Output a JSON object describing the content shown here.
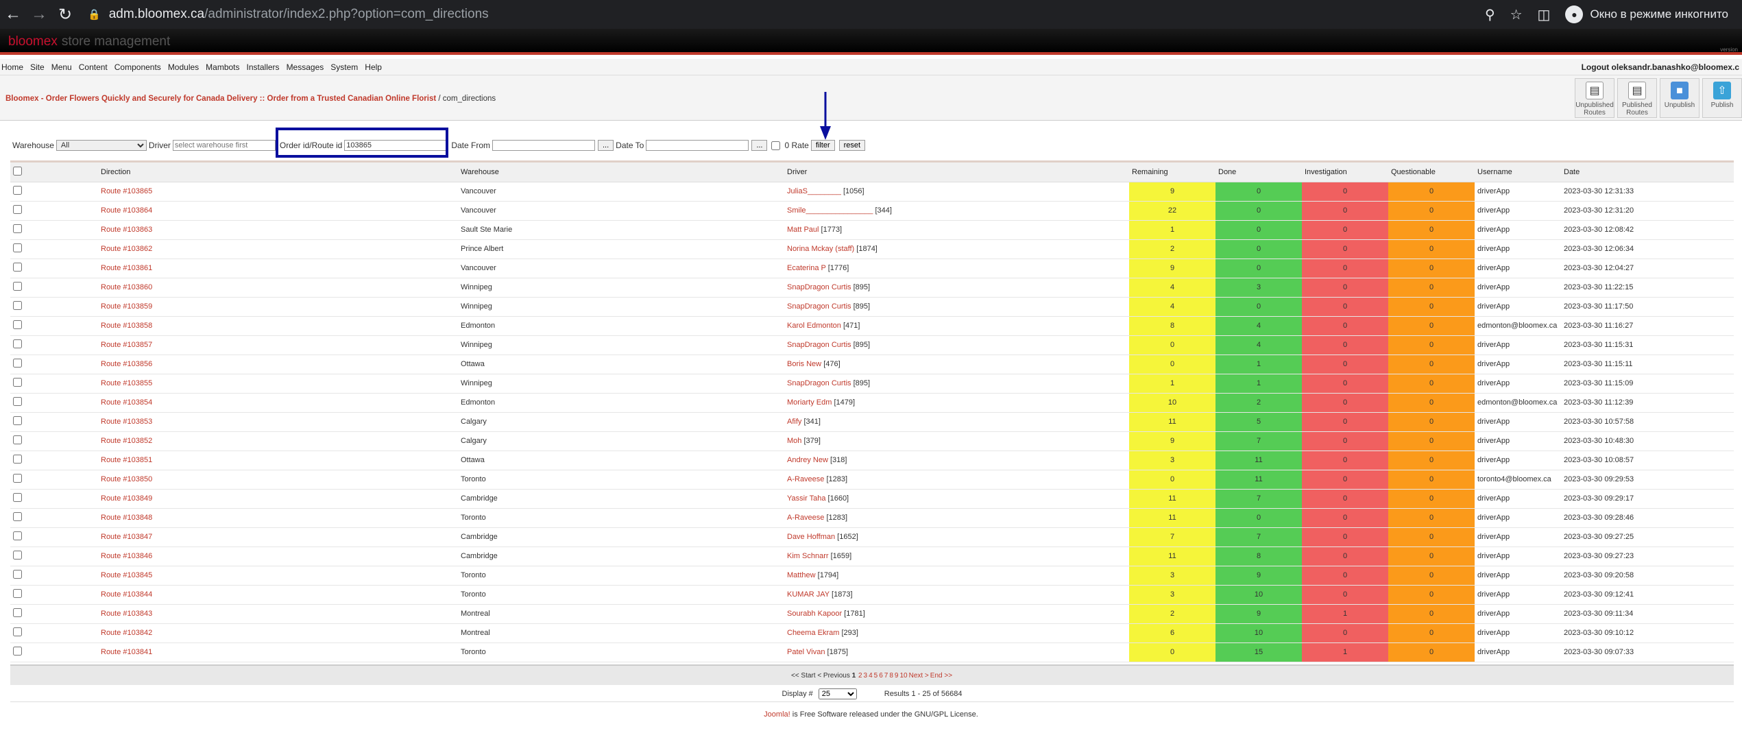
{
  "browser": {
    "url_host": "adm.bloomex.ca",
    "url_path": "/administrator/index2.php?option=com_directions",
    "incognito_label": "Окно в режиме инкогнито"
  },
  "header": {
    "brand_name": "bloomex",
    "brand_suffix": "store management",
    "version": "version"
  },
  "menu": {
    "items": [
      "Home",
      "Site",
      "Menu",
      "Content",
      "Components",
      "Modules",
      "Mambots",
      "Installers",
      "Messages",
      "System",
      "Help"
    ],
    "logout": "Logout oleksandr.banashko@bloomex.c"
  },
  "breadcrumb": {
    "site": "Bloomex - Order Flowers Quickly and Securely for Canada Delivery :: Order from a Trusted Canadian Online Florist",
    "component": "/ com_directions"
  },
  "toolbar": [
    {
      "label": "Unpublished Routes",
      "icon": "doc-icon"
    },
    {
      "label": "Published Routes",
      "icon": "doc-icon"
    },
    {
      "label": "Unpublish",
      "icon": "folder-icon"
    },
    {
      "label": "Publish",
      "icon": "publish-icon"
    }
  ],
  "filters": {
    "warehouse_label": "Warehouse",
    "warehouse_value": "All",
    "driver_label": "Driver",
    "driver_placeholder": "select warehouse first",
    "order_label": "Order id/Route id",
    "order_value": "103865",
    "date_from_label": "Date From",
    "date_to_label": "Date To",
    "picker_label": "...",
    "rate_label": "0 Rate",
    "filter_button": "filter",
    "reset_button": "reset"
  },
  "table": {
    "headers": {
      "direction": "Direction",
      "warehouse": "Warehouse",
      "driver": "Driver",
      "remaining": "Remaining",
      "done": "Done",
      "investigation": "Investigation",
      "questionable": "Questionable",
      "username": "Username",
      "date": "Date"
    },
    "rows": [
      {
        "route": "Route #103865",
        "warehouse": "Vancouver",
        "driver": "JuliaS________",
        "driver_id": "[1056]",
        "remaining": "9",
        "done": "0",
        "inv": "0",
        "que": "0",
        "user": "driverApp",
        "date": "2023-03-30 12:31:33"
      },
      {
        "route": "Route #103864",
        "warehouse": "Vancouver",
        "driver": "Smile________________",
        "driver_id": "[344]",
        "remaining": "22",
        "done": "0",
        "inv": "0",
        "que": "0",
        "user": "driverApp",
        "date": "2023-03-30 12:31:20"
      },
      {
        "route": "Route #103863",
        "warehouse": "Sault Ste Marie",
        "driver": "Matt Paul",
        "driver_id": "[1773]",
        "remaining": "1",
        "done": "0",
        "inv": "0",
        "que": "0",
        "user": "driverApp",
        "date": "2023-03-30 12:08:42"
      },
      {
        "route": "Route #103862",
        "warehouse": "Prince Albert",
        "driver": "Norina Mckay (staff)",
        "driver_id": "[1874]",
        "remaining": "2",
        "done": "0",
        "inv": "0",
        "que": "0",
        "user": "driverApp",
        "date": "2023-03-30 12:06:34"
      },
      {
        "route": "Route #103861",
        "warehouse": "Vancouver",
        "driver": "Ecaterina P",
        "driver_id": "[1776]",
        "remaining": "9",
        "done": "0",
        "inv": "0",
        "que": "0",
        "user": "driverApp",
        "date": "2023-03-30 12:04:27"
      },
      {
        "route": "Route #103860",
        "warehouse": "Winnipeg",
        "driver": "SnapDragon Curtis",
        "driver_id": "[895]",
        "remaining": "4",
        "done": "3",
        "inv": "0",
        "que": "0",
        "user": "driverApp",
        "date": "2023-03-30 11:22:15"
      },
      {
        "route": "Route #103859",
        "warehouse": "Winnipeg",
        "driver": "SnapDragon Curtis",
        "driver_id": "[895]",
        "remaining": "4",
        "done": "0",
        "inv": "0",
        "que": "0",
        "user": "driverApp",
        "date": "2023-03-30 11:17:50"
      },
      {
        "route": "Route #103858",
        "warehouse": "Edmonton",
        "driver": "Karol Edmonton",
        "driver_id": "[471]",
        "remaining": "8",
        "done": "4",
        "inv": "0",
        "que": "0",
        "user": "edmonton@bloomex.ca",
        "date": "2023-03-30 11:16:27"
      },
      {
        "route": "Route #103857",
        "warehouse": "Winnipeg",
        "driver": "SnapDragon Curtis",
        "driver_id": "[895]",
        "remaining": "0",
        "done": "4",
        "inv": "0",
        "que": "0",
        "user": "driverApp",
        "date": "2023-03-30 11:15:31"
      },
      {
        "route": "Route #103856",
        "warehouse": "Ottawa",
        "driver": "Boris New",
        "driver_id": "[476]",
        "remaining": "0",
        "done": "1",
        "inv": "0",
        "que": "0",
        "user": "driverApp",
        "date": "2023-03-30 11:15:11"
      },
      {
        "route": "Route #103855",
        "warehouse": "Winnipeg",
        "driver": "SnapDragon Curtis",
        "driver_id": "[895]",
        "remaining": "1",
        "done": "1",
        "inv": "0",
        "que": "0",
        "user": "driverApp",
        "date": "2023-03-30 11:15:09"
      },
      {
        "route": "Route #103854",
        "warehouse": "Edmonton",
        "driver": "Moriarty Edm",
        "driver_id": "[1479]",
        "remaining": "10",
        "done": "2",
        "inv": "0",
        "que": "0",
        "user": "edmonton@bloomex.ca",
        "date": "2023-03-30 11:12:39"
      },
      {
        "route": "Route #103853",
        "warehouse": "Calgary",
        "driver": "Afify",
        "driver_id": "[341]",
        "remaining": "11",
        "done": "5",
        "inv": "0",
        "que": "0",
        "user": "driverApp",
        "date": "2023-03-30 10:57:58"
      },
      {
        "route": "Route #103852",
        "warehouse": "Calgary",
        "driver": "Moh",
        "driver_id": "[379]",
        "remaining": "9",
        "done": "7",
        "inv": "0",
        "que": "0",
        "user": "driverApp",
        "date": "2023-03-30 10:48:30"
      },
      {
        "route": "Route #103851",
        "warehouse": "Ottawa",
        "driver": "Andrey New",
        "driver_id": "[318]",
        "remaining": "3",
        "done": "11",
        "inv": "0",
        "que": "0",
        "user": "driverApp",
        "date": "2023-03-30 10:08:57"
      },
      {
        "route": "Route #103850",
        "warehouse": "Toronto",
        "driver": "A-Raveese",
        "driver_id": "[1283]",
        "remaining": "0",
        "done": "11",
        "inv": "0",
        "que": "0",
        "user": "toronto4@bloomex.ca",
        "date": "2023-03-30 09:29:53"
      },
      {
        "route": "Route #103849",
        "warehouse": "Cambridge",
        "driver": "Yassir Taha",
        "driver_id": "[1660]",
        "remaining": "11",
        "done": "7",
        "inv": "0",
        "que": "0",
        "user": "driverApp",
        "date": "2023-03-30 09:29:17"
      },
      {
        "route": "Route #103848",
        "warehouse": "Toronto",
        "driver": "A-Raveese",
        "driver_id": "[1283]",
        "remaining": "11",
        "done": "0",
        "inv": "0",
        "que": "0",
        "user": "driverApp",
        "date": "2023-03-30 09:28:46"
      },
      {
        "route": "Route #103847",
        "warehouse": "Cambridge",
        "driver": "Dave Hoffman",
        "driver_id": "[1652]",
        "remaining": "7",
        "done": "7",
        "inv": "0",
        "que": "0",
        "user": "driverApp",
        "date": "2023-03-30 09:27:25"
      },
      {
        "route": "Route #103846",
        "warehouse": "Cambridge",
        "driver": "Kim Schnarr",
        "driver_id": "[1659]",
        "remaining": "11",
        "done": "8",
        "inv": "0",
        "que": "0",
        "user": "driverApp",
        "date": "2023-03-30 09:27:23"
      },
      {
        "route": "Route #103845",
        "warehouse": "Toronto",
        "driver": "Matthew",
        "driver_id": "[1794]",
        "remaining": "3",
        "done": "9",
        "inv": "0",
        "que": "0",
        "user": "driverApp",
        "date": "2023-03-30 09:20:58"
      },
      {
        "route": "Route #103844",
        "warehouse": "Toronto",
        "driver": "KUMAR JAY",
        "driver_id": "[1873]",
        "remaining": "3",
        "done": "10",
        "inv": "0",
        "que": "0",
        "user": "driverApp",
        "date": "2023-03-30 09:12:41"
      },
      {
        "route": "Route #103843",
        "warehouse": "Montreal",
        "driver": "Sourabh Kapoor",
        "driver_id": "[1781]",
        "remaining": "2",
        "done": "9",
        "inv": "1",
        "que": "0",
        "user": "driverApp",
        "date": "2023-03-30 09:11:34"
      },
      {
        "route": "Route #103842",
        "warehouse": "Montreal",
        "driver": "Cheema Ekram",
        "driver_id": "[293]",
        "remaining": "6",
        "done": "10",
        "inv": "0",
        "que": "0",
        "user": "driverApp",
        "date": "2023-03-30 09:10:12"
      },
      {
        "route": "Route #103841",
        "warehouse": "Toronto",
        "driver": "Patel Vivan",
        "driver_id": "[1875]",
        "remaining": "0",
        "done": "15",
        "inv": "1",
        "que": "0",
        "user": "driverApp",
        "date": "2023-03-30 09:07:33"
      }
    ]
  },
  "pager": {
    "start": "<< Start",
    "prev": "< Previous",
    "current": "1",
    "pages": [
      "2",
      "3",
      "4",
      "5",
      "6",
      "7",
      "8",
      "9",
      "10"
    ],
    "next": "Next >",
    "end": "End >>"
  },
  "display": {
    "label": "Display #",
    "value": "25",
    "results": "Results 1 - 25 of 56684"
  },
  "footer": {
    "link": "Joomla!",
    "text": " is Free Software released under the GNU/GPL License."
  },
  "colors": {
    "remaining": "#f5f53a",
    "done": "#55cc55",
    "investigation": "#f06060",
    "questionable": "#fb9a1a",
    "link": "#c0392b",
    "highlight_box": "#0a0f9e"
  }
}
